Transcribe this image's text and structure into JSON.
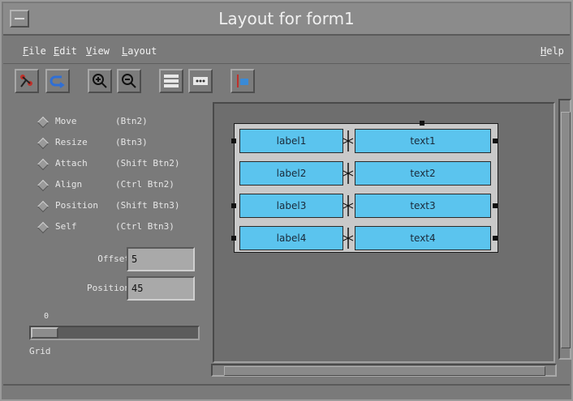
{
  "window": {
    "title": "Layout for form1"
  },
  "menu": {
    "file": "File",
    "edit": "Edit",
    "view": "View",
    "layout": "Layout",
    "help": "Help"
  },
  "toolbar": {
    "icons": [
      "tree-icon",
      "undo-icon",
      "zoom-in-icon",
      "zoom-out-icon",
      "grid-icon",
      "dots-icon",
      "align-icon"
    ]
  },
  "modes": [
    {
      "label": "Move",
      "key": "(Btn2)"
    },
    {
      "label": "Resize",
      "key": "(Btn3)"
    },
    {
      "label": "Attach",
      "key": "(Shift Btn2)"
    },
    {
      "label": "Align",
      "key": "(Ctrl Btn2)"
    },
    {
      "label": "Position",
      "key": "(Shift Btn3)"
    },
    {
      "label": "Self",
      "key": "(Ctrl Btn3)"
    }
  ],
  "offset": {
    "label": "Offset",
    "value": "5"
  },
  "position": {
    "label": "Position",
    "value": "45"
  },
  "grid": {
    "label": "Grid",
    "value": "0"
  },
  "form": {
    "rows": [
      {
        "label": "label1",
        "text": "text1"
      },
      {
        "label": "label2",
        "text": "text2"
      },
      {
        "label": "label3",
        "text": "text3"
      },
      {
        "label": "label4",
        "text": "text4"
      }
    ]
  },
  "colors": {
    "widget": "#5bc4ee",
    "chrome": "#7a7a7a"
  }
}
